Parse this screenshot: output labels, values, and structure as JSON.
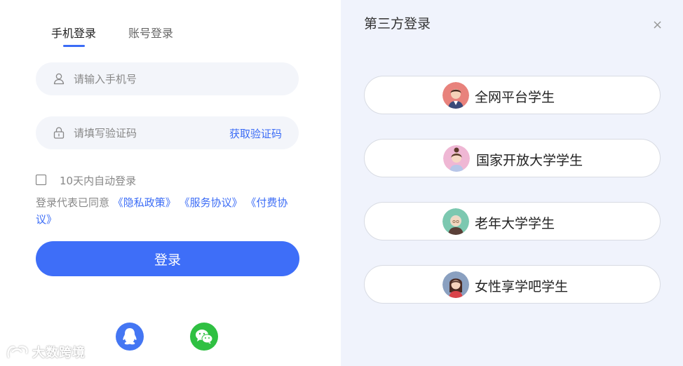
{
  "tabs": {
    "phone": "手机登录",
    "account": "账号登录"
  },
  "phone_field": {
    "placeholder": "请输入手机号",
    "icon": "user-icon"
  },
  "code_field": {
    "placeholder": "请填写验证码",
    "icon": "lock-icon",
    "get_code": "获取验证码"
  },
  "remember": {
    "label": "10天内自动登录",
    "checked": false
  },
  "agreement": {
    "prefix": "登录代表已同意",
    "privacy": "《隐私政策》",
    "service": "《服务协议》",
    "payment": "《付费协议》"
  },
  "login_button": "登录",
  "social": [
    {
      "name": "qq",
      "icon": "qq-icon",
      "color": "#4476f3"
    },
    {
      "name": "wechat",
      "icon": "wechat-icon",
      "color": "#2fc042"
    }
  ],
  "watermark": "大数跨境",
  "third_party": {
    "title": "第三方登录",
    "close_icon": "×",
    "options": [
      {
        "label": "全网平台学生",
        "avatar": "student-avatar"
      },
      {
        "label": "国家开放大学学生",
        "avatar": "girl-avatar"
      },
      {
        "label": "老年大学学生",
        "avatar": "elder-avatar"
      },
      {
        "label": "女性享学吧学生",
        "avatar": "woman-avatar"
      }
    ]
  },
  "colors": {
    "accent": "#3e6ef8",
    "panel_bg": "#f0f3fc",
    "field_bg": "#f3f5fa"
  }
}
